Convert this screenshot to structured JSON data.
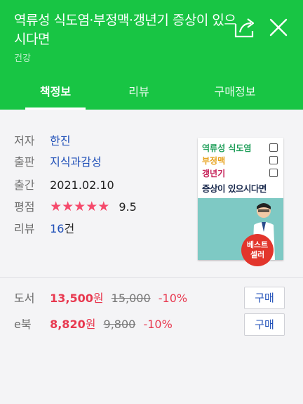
{
  "header": {
    "title": "역류성 식도염·부정맥·갱년기 증상이 있으시다면",
    "category": "건강",
    "share_icon": "share-icon",
    "close_icon": "close-icon"
  },
  "tabs": [
    {
      "label": "책정보",
      "active": true
    },
    {
      "label": "리뷰",
      "active": false
    },
    {
      "label": "구매정보",
      "active": false
    }
  ],
  "book": {
    "author_label": "저자",
    "author": "한진",
    "publisher_label": "출판",
    "publisher": "지식과감성",
    "published_label": "출간",
    "published": "2021.02.10",
    "rating_label": "평점",
    "stars": "★★★★★",
    "rating": 5.0,
    "score": "9.5",
    "review_label": "리뷰",
    "review_count": "16",
    "review_unit": "건",
    "cover": {
      "line1": "역류성 식도염",
      "line2": "부정맥",
      "line3": "갱년기",
      "line4": "증상이 있으시다면",
      "badge": [
        "베스트",
        "셀러"
      ]
    }
  },
  "prices": [
    {
      "label": "도서",
      "price": "13,500",
      "unit": "원",
      "original": "15,000",
      "discount": "-10%",
      "buy": "구매"
    },
    {
      "label": "e북",
      "price": "8,820",
      "unit": "원",
      "original": "9,800",
      "discount": "-10%",
      "buy": "구매"
    }
  ],
  "colors": {
    "header_green": "#18c544",
    "link_blue": "#1f4fb8",
    "price_red": "#e8384f",
    "star_pink": "#f5496b"
  }
}
